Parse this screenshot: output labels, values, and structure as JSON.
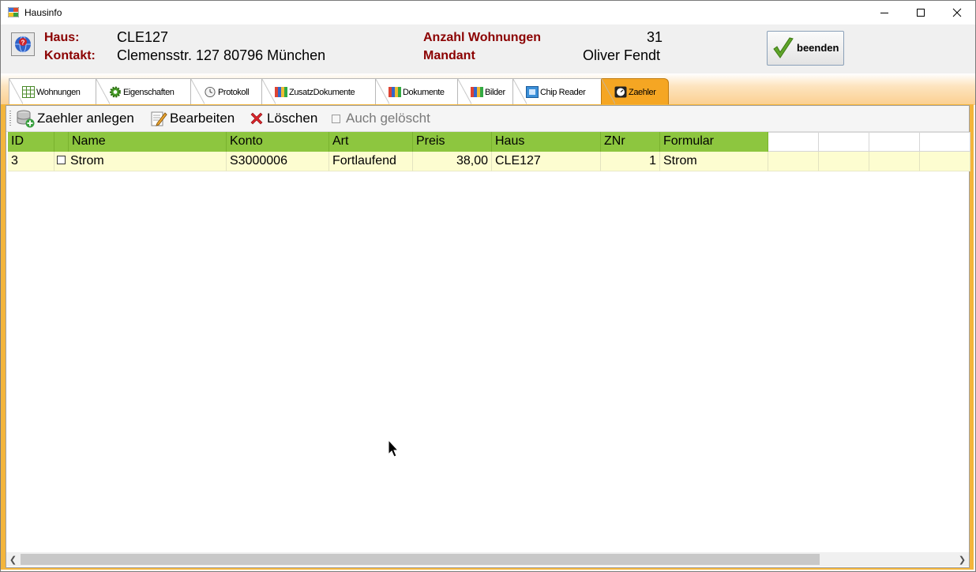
{
  "window": {
    "title": "Hausinfo"
  },
  "header": {
    "haus_label": "Haus:",
    "haus_value": "CLE127",
    "kontakt_label": "Kontakt:",
    "kontakt_value": "Clemensstr. 127 80796 München",
    "anzahl_label": "Anzahl Wohnungen",
    "anzahl_value": "31",
    "mandant_label": "Mandant",
    "mandant_value": "Oliver Fendt",
    "beenden_label": "beenden"
  },
  "tabs": [
    {
      "label": "Wohnungen",
      "icon": "grid-icon"
    },
    {
      "label": "Eigenschaften",
      "icon": "gear-icon"
    },
    {
      "label": "Protokoll",
      "icon": "clock-icon"
    },
    {
      "label": "ZusatzDokumente",
      "icon": "binders-icon"
    },
    {
      "label": "Dokumente",
      "icon": "binders-icon"
    },
    {
      "label": "Bilder",
      "icon": "binders-icon"
    },
    {
      "label": "Chip Reader",
      "icon": "chip-reader-icon"
    },
    {
      "label": "Zaehler",
      "icon": "meter-icon",
      "active": true
    }
  ],
  "toolbar": {
    "add_label": "Zaehler anlegen",
    "edit_label": "Bearbeiten",
    "delete_label": "Löschen",
    "deleted_label": "Auch gelöscht",
    "deleted_checked": false
  },
  "grid": {
    "columns": [
      "ID",
      "",
      "Name",
      "Konto",
      "Art",
      "Preis",
      "Haus",
      "ZNr",
      "Formular"
    ],
    "rows": [
      {
        "id": "3",
        "checked": false,
        "name": "Strom",
        "konto": "S3000006",
        "art": "Fortlaufend",
        "preis": "38,00",
        "haus": "CLE127",
        "znr": "1",
        "formular": "Strom"
      }
    ]
  },
  "colors": {
    "header_label": "#8b0000",
    "grid_header": "#8dc63f",
    "row_bg": "#fdfdd0",
    "active_tab": "#f5a623",
    "frame": "#f3b53c"
  }
}
